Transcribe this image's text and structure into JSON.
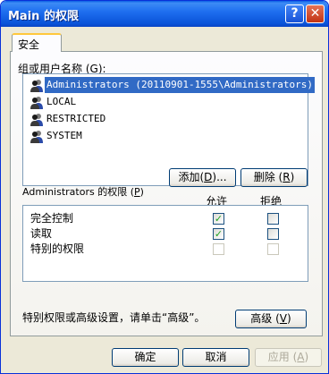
{
  "window": {
    "title": "Main 的权限",
    "help_glyph": "?",
    "close_glyph": "✕"
  },
  "tab": {
    "label": "安全"
  },
  "group_list": {
    "label_pre": "组或用户名称 (",
    "label_key": "G",
    "label_post": "):",
    "items": [
      {
        "label": "Administrators (20110901-1555\\Administrators)",
        "selected": true
      },
      {
        "label": "LOCAL",
        "selected": false
      },
      {
        "label": "RESTRICTED",
        "selected": false
      },
      {
        "label": "SYSTEM",
        "selected": false
      }
    ]
  },
  "buttons": {
    "add": {
      "pre": "添加(",
      "key": "D",
      "post": ")..."
    },
    "remove": {
      "pre": "删除 (",
      "key": "R",
      "post": ")"
    },
    "advanced": {
      "pre": "高级 (",
      "key": "V",
      "post": ")"
    },
    "ok": "确定",
    "cancel": "取消",
    "apply": {
      "pre": "应用 (",
      "key": "A",
      "post": ")"
    }
  },
  "permissions": {
    "label_pre": "Administrators 的权限 (",
    "label_key": "P",
    "label_post": ")",
    "allow_header": "允许",
    "deny_header": "拒绝",
    "rows": [
      {
        "name": "完全控制",
        "allow": true,
        "deny": false,
        "enabled": true
      },
      {
        "name": "读取",
        "allow": true,
        "deny": false,
        "enabled": true
      },
      {
        "name": "特别的权限",
        "allow": false,
        "deny": false,
        "enabled": false
      }
    ]
  },
  "note": "特别权限或高级设置，请单击“高级”。",
  "colors": {
    "title_bar": "#0a53d8",
    "selection": "#316ac5",
    "face": "#ece9d8",
    "check": "#21a121"
  },
  "icons": {
    "user_group": "user-group-icon",
    "check": "checkmark-icon"
  }
}
